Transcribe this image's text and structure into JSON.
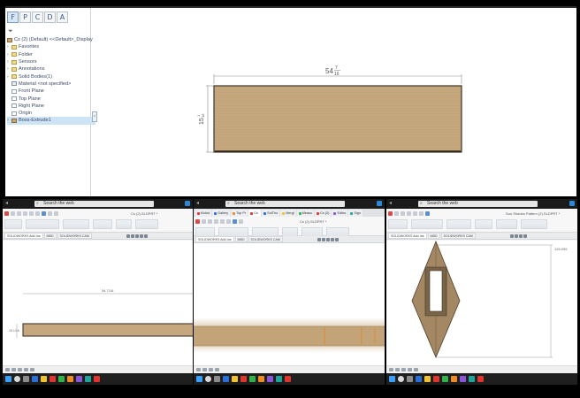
{
  "main_view": {
    "feature_tabs": [
      "F",
      "P",
      "C",
      "D",
      "A"
    ],
    "tree": {
      "root": "Cs (2) (Default) <<Default>_Display",
      "items": [
        {
          "label": "Favorites",
          "type": "folder"
        },
        {
          "label": "Folder",
          "type": "folder"
        },
        {
          "label": "Sensors",
          "type": "folder"
        },
        {
          "label": "Annotations",
          "type": "folder"
        },
        {
          "label": "Solid Bodies(1)",
          "type": "folder"
        },
        {
          "label": "Material <not specified>",
          "type": "material"
        },
        {
          "label": "Front Plane",
          "type": "plane"
        },
        {
          "label": "Top Plane",
          "type": "plane"
        },
        {
          "label": "Right Plane",
          "type": "plane"
        },
        {
          "label": "Origin",
          "type": "origin"
        },
        {
          "label": "Boss-Extrude1",
          "type": "feature"
        }
      ]
    },
    "dimensions": {
      "width_whole": "54",
      "width_num": "7",
      "width_den": "16",
      "height_whole": "15",
      "height_num": "1",
      "height_den": "16"
    },
    "colors": {
      "wood": "#c4a57c",
      "wood_edge": "#3b3325",
      "dim_line": "#8a8a8a"
    }
  },
  "panes": [
    {
      "search_placeholder": "Search the web",
      "doc_title": "Cs (2).SLDPRT *",
      "tabs": [
        "SOLIDWORKS Add-Ins",
        "MBD",
        "SOLIDWORKS CAM"
      ],
      "dims": {
        "width": "54 7/16",
        "height": "15 1/16"
      }
    },
    {
      "search_placeholder": "Search the web",
      "doc_title": "Cs (2).SLDPRT *",
      "browser_tabs": [
        "Kickst",
        "Gallery",
        "Top Pr",
        "Cs",
        "SolTho",
        "Mergi",
        "Measu",
        "Cs (2)",
        "Editor",
        "Sign"
      ],
      "tabs": [
        "SOLIDWORKS Add-Ins",
        "MBD",
        "SOLIDWORKS CAM"
      ]
    },
    {
      "search_placeholder": "Search the web",
      "doc_title": "Sun Shades Pattern (2).SLDPRT *",
      "tabs": [
        "SOLIDWORKS Add-Ins",
        "MBD",
        "SOLIDWORKS CAM"
      ],
      "dims": {
        "overall": "126.095"
      }
    }
  ]
}
